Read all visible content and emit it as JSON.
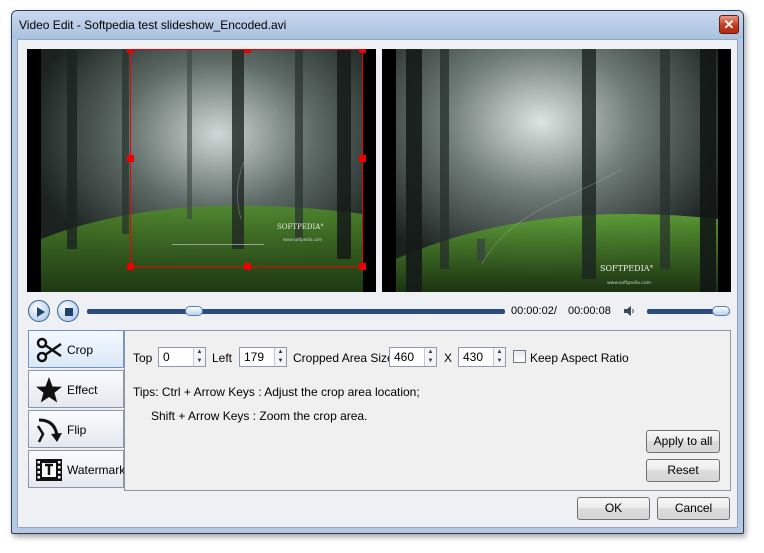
{
  "window": {
    "title": "Video Edit - Softpedia test slideshow_Encoded.avi",
    "close_glyph": "✕"
  },
  "preview": {
    "left_watermark": "SOFTPEDIA°",
    "left_watermark_sub": "www.softpedia.com",
    "right_watermark": "SOFTPEDIA°",
    "right_watermark_sub": "www.softpedia.com"
  },
  "playback": {
    "play_icon": "play-icon",
    "stop_icon": "stop-icon",
    "current_time": "00:00:02/",
    "total_time": "00:00:08",
    "seek_progress": 0.245,
    "volume_icon": "speaker-icon",
    "volume_level": 1.0
  },
  "tabs": [
    {
      "label": "Crop",
      "icon": "scissors-icon",
      "active": true
    },
    {
      "label": "Effect",
      "icon": "star-icon",
      "active": false
    },
    {
      "label": "Flip",
      "icon": "flip-arrow-icon",
      "active": false
    },
    {
      "label": "Watermark",
      "icon": "film-text-icon",
      "active": false
    }
  ],
  "crop": {
    "top_label": "Top",
    "top_value": "0",
    "left_label": "Left",
    "left_value": "179",
    "area_label": "Cropped Area Size",
    "width_value": "460",
    "x_label": "X",
    "height_value": "430",
    "keep_aspect_label": "Keep Aspect Ratio",
    "keep_aspect_checked": false,
    "tip_line1": "Tips: Ctrl   + Arrow Keys : Adjust the crop area location;",
    "tip_line2": "Shift + Arrow Keys : Zoom the crop area.",
    "apply_all_label": "Apply to all",
    "reset_label": "Reset"
  },
  "footer": {
    "ok_label": "OK",
    "cancel_label": "Cancel"
  },
  "colors": {
    "crop_frame": "#ee0000",
    "track": "#2b4d7d"
  }
}
